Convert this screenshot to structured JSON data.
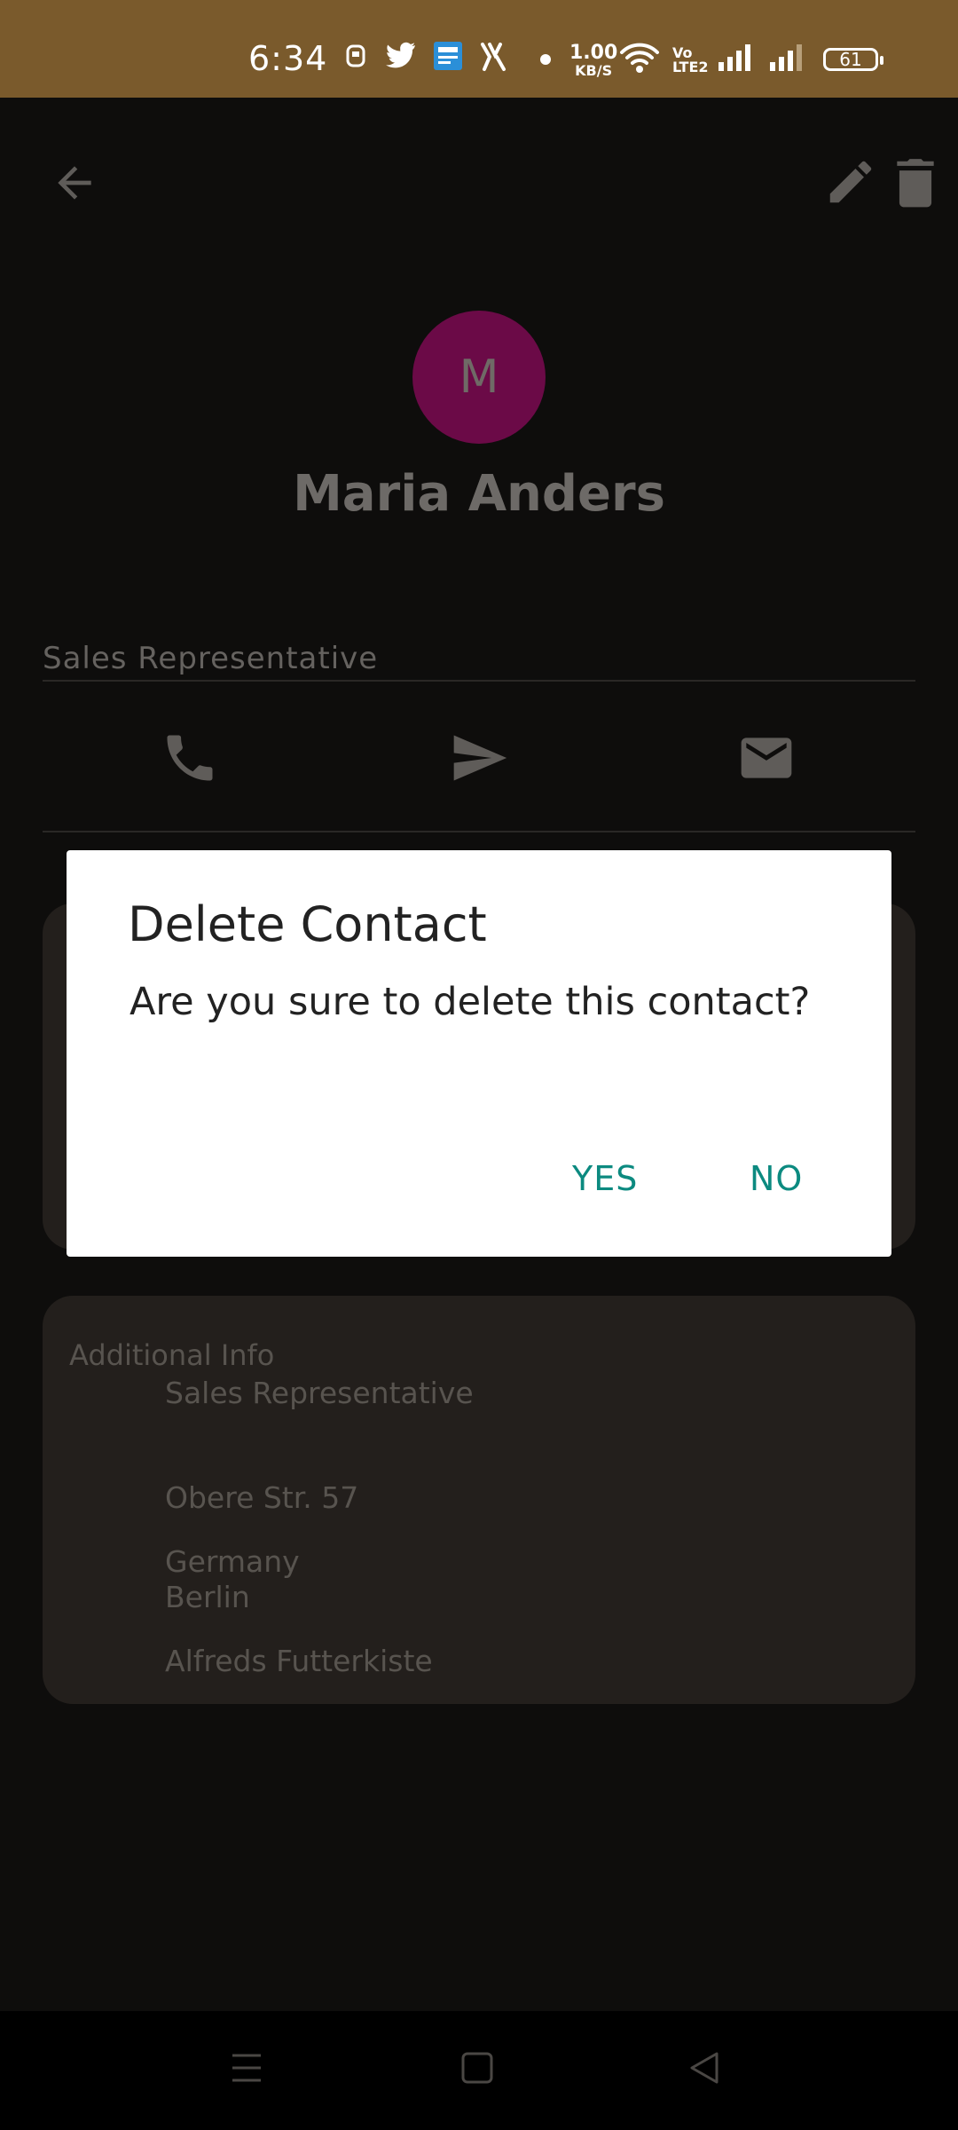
{
  "status_bar": {
    "time": "6:34",
    "net_speed_value": "1.00",
    "net_speed_unit": "KB/S",
    "volte_top": "Vo",
    "volte_bottom": "LTE2",
    "battery": "61"
  },
  "toolbar": {
    "back_icon": "arrow-left-icon",
    "edit_icon": "pencil-icon",
    "delete_icon": "trash-icon"
  },
  "contact": {
    "avatar_initial": "M",
    "avatar_color": "#6b0a47",
    "name": "Maria Anders",
    "job_title": "Sales Representative"
  },
  "actions": [
    "phone-icon",
    "send-icon",
    "mail-icon"
  ],
  "additional_info": {
    "title": "Additional Info",
    "lines": [
      "Sales Representative",
      "Obere Str.  57",
      "Germany",
      "Berlin",
      "Alfreds Futterkiste"
    ]
  },
  "dialog": {
    "title": "Delete Contact",
    "message": "Are you sure to delete this contact?",
    "yes_label": "YES",
    "no_label": "NO",
    "accent_color": "#0c8a80"
  },
  "nav_bar": [
    "menu-icon",
    "home-square-icon",
    "back-triangle-icon"
  ]
}
